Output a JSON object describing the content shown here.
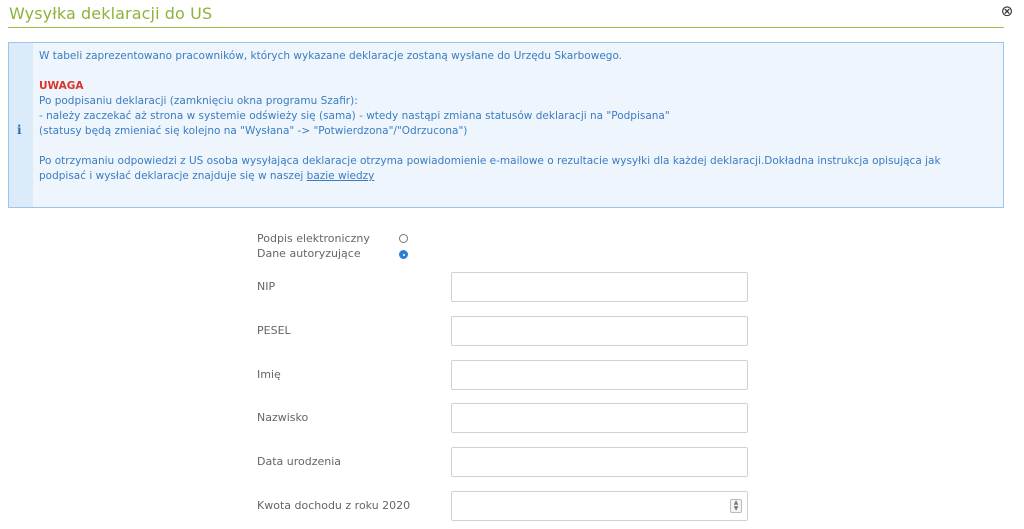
{
  "header": {
    "title": "Wysyłka deklaracji do US",
    "close_glyph": "⊗"
  },
  "info": {
    "icon": "i",
    "line1": "W tabeli zaprezentowano pracowników, których wykazane deklaracje zostaną wysłane do Urzędu Skarbowego.",
    "warning_title": "UWAGA",
    "line2": "Po podpisaniu deklaracji (zamknięciu okna programu Szafir):",
    "line3": "- należy zaczekać aż strona w systemie odświeży się (sama) - wtedy nastąpi zmiana statusów deklaracji na \"Podpisana\"",
    "line4": "(statusy będą zmieniać się kolejno na \"Wysłana\" -> \"Potwierdzona\"/\"Odrzucona\")",
    "line5": "Po otrzymaniu odpowiedzi z US osoba wysyłająca deklaracje otrzyma powiadomienie e-mailowe o rezultacie wysyłki dla każdej deklaracji.Dokładna instrukcja opisująca jak",
    "line6_prefix": "podpisać i wysłać deklaracje znajduje się w naszej ",
    "link_text": "bazie wiedzy"
  },
  "auth": {
    "option1": "Podpis elektroniczny",
    "option2": "Dane autoryzujące",
    "selected": "Dane autoryzujące"
  },
  "fields": {
    "nip": {
      "label": "NIP",
      "value": ""
    },
    "pesel": {
      "label": "PESEL",
      "value": ""
    },
    "imie": {
      "label": "Imię",
      "value": ""
    },
    "nazwisko": {
      "label": "Nazwisko",
      "value": ""
    },
    "data_urodzenia": {
      "label": "Data urodzenia",
      "value": ""
    },
    "kwota": {
      "label": "Kwota dochodu z roku 2020",
      "value": ""
    }
  },
  "colors": {
    "title_green": "#8cb43c",
    "info_blue": "#3a7cc4",
    "warning_red": "#d9342b",
    "radio_selected": "#2d7fd6"
  }
}
